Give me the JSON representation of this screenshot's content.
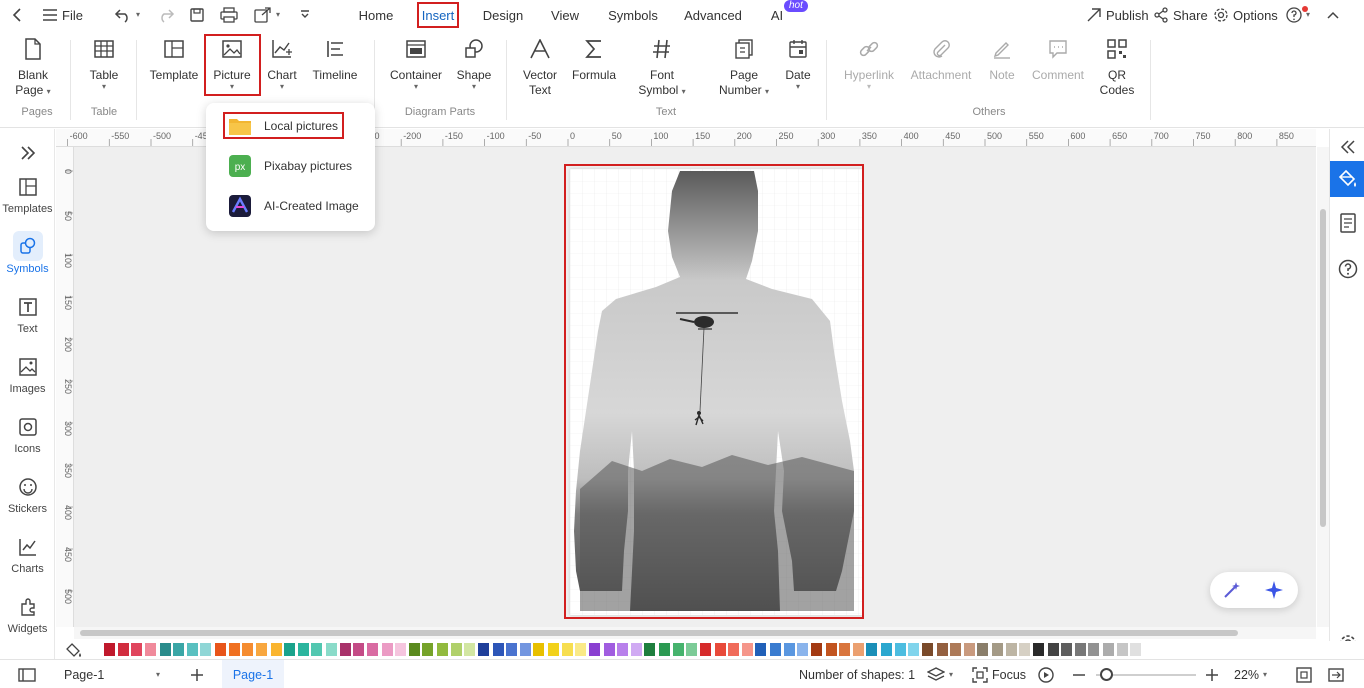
{
  "menubar": {
    "file_label": "File",
    "tabs": [
      {
        "label": "Home"
      },
      {
        "label": "Insert"
      },
      {
        "label": "Design"
      },
      {
        "label": "View"
      },
      {
        "label": "Symbols"
      },
      {
        "label": "Advanced"
      },
      {
        "label": "AI"
      }
    ],
    "hot_badge": "hot",
    "publish_label": "Publish",
    "share_label": "Share",
    "options_label": "Options"
  },
  "ribbon": {
    "blank_page": {
      "line1": "Blank",
      "line2": "Page"
    },
    "table": "Table",
    "template": "Template",
    "picture": "Picture",
    "chart": "Chart",
    "timeline": "Timeline",
    "container": "Container",
    "shape": "Shape",
    "vector_text": {
      "line1": "Vector",
      "line2": "Text"
    },
    "formula": "Formula",
    "font_symbol": {
      "line1": "Font",
      "line2": "Symbol"
    },
    "page_number": {
      "line1": "Page",
      "line2": "Number"
    },
    "date": "Date",
    "hyperlink": "Hyperlink",
    "attachment": "Attachment",
    "note": "Note",
    "comment": "Comment",
    "qr_codes": {
      "line1": "QR",
      "line2": "Codes"
    },
    "groups": {
      "pages": "Pages",
      "table": "Table",
      "diagram_parts": "Diagram Parts",
      "text": "Text",
      "others": "Others"
    }
  },
  "picture_menu": {
    "items": [
      {
        "label": "Local pictures",
        "icon": "folder-icon",
        "color": "#f7c548"
      },
      {
        "label": "Pixabay pictures",
        "icon": "pixabay-icon",
        "color": "#4caf50"
      },
      {
        "label": "AI-Created Image",
        "icon": "ai-image-icon",
        "color": "#1b1b3a"
      }
    ],
    "pixabay_glyph": "px"
  },
  "sidebar": {
    "items": [
      {
        "label": "Templates",
        "icon": "templates-icon"
      },
      {
        "label": "Symbols",
        "icon": "symbols-icon",
        "active": true
      },
      {
        "label": "Text",
        "icon": "text-icon"
      },
      {
        "label": "Images",
        "icon": "images-icon"
      },
      {
        "label": "Icons",
        "icon": "icons-icon"
      },
      {
        "label": "Stickers",
        "icon": "stickers-icon"
      },
      {
        "label": "Charts",
        "icon": "charts-icon"
      },
      {
        "label": "Widgets",
        "icon": "widgets-icon"
      }
    ]
  },
  "ruler": {
    "top_labels": [
      "-600",
      "-550",
      "-500",
      "-450",
      "-400",
      "-350",
      "-300",
      "-250",
      "-200",
      "-150",
      "-100",
      "-50",
      "0",
      "50",
      "100",
      "150",
      "200",
      "250",
      "300",
      "350",
      "400",
      "450",
      "500",
      "550",
      "600",
      "650",
      "700",
      "750",
      "800",
      "850",
      "900"
    ],
    "left_labels": [
      "0",
      "50",
      "100",
      "150",
      "200",
      "250",
      "300",
      "350",
      "400",
      "450",
      "500"
    ]
  },
  "statusbar": {
    "page_select": "Page-1",
    "active_page_tab": "Page-1",
    "shapes_count": "Number of shapes: 1",
    "focus_label": "Focus",
    "zoom": "22%"
  },
  "colors": {
    "accent": "#1a73e8",
    "highlight": "#d21f1f",
    "active_tab": "#1565c0",
    "palette": [
      "#c0192c",
      "#d12d3f",
      "#e0455d",
      "#f08a9b",
      "#2a8c8c",
      "#3aa6a6",
      "#59c0c0",
      "#8fd6d6",
      "#e8551a",
      "#f07020",
      "#f58c30",
      "#f8a73f",
      "#fab52f",
      "#1aa38c",
      "#2bb59e",
      "#52c7b0",
      "#8adbc9",
      "#a8326a",
      "#c44b86",
      "#d96ba2",
      "#eb9bc4",
      "#f5c5de",
      "#5a8a1e",
      "#76a32a",
      "#92ba3e",
      "#b0d06a",
      "#d2e6a2",
      "#1f3f9a",
      "#2d56b8",
      "#4a73cf",
      "#7396e0",
      "#e8c000",
      "#f2d11a",
      "#f7de4f",
      "#faea87",
      "#8a3fd1",
      "#a15de0",
      "#b880eb",
      "#d0aaf3",
      "#1e7f3e",
      "#2b9a52",
      "#46b36d",
      "#7ccb97",
      "#d62b2b",
      "#e84a3a",
      "#f06b5a",
      "#f5968a",
      "#2160b8",
      "#3a7cd0",
      "#5a97e0",
      "#8ab4ec",
      "#a33a12",
      "#c2541f",
      "#d9753d",
      "#eba070",
      "#1a8fb8",
      "#2ba7cf",
      "#4dbde0",
      "#80d4ec",
      "#7a4a2a",
      "#946040",
      "#ad7a58",
      "#c99a7e",
      "#8a7e6a",
      "#a49a86",
      "#bdb5a4",
      "#d6d0c4",
      "#2a2a2a",
      "#444444",
      "#5e5e5e",
      "#787878",
      "#929292",
      "#acacac",
      "#c6c6c6",
      "#e0e0e0"
    ]
  }
}
